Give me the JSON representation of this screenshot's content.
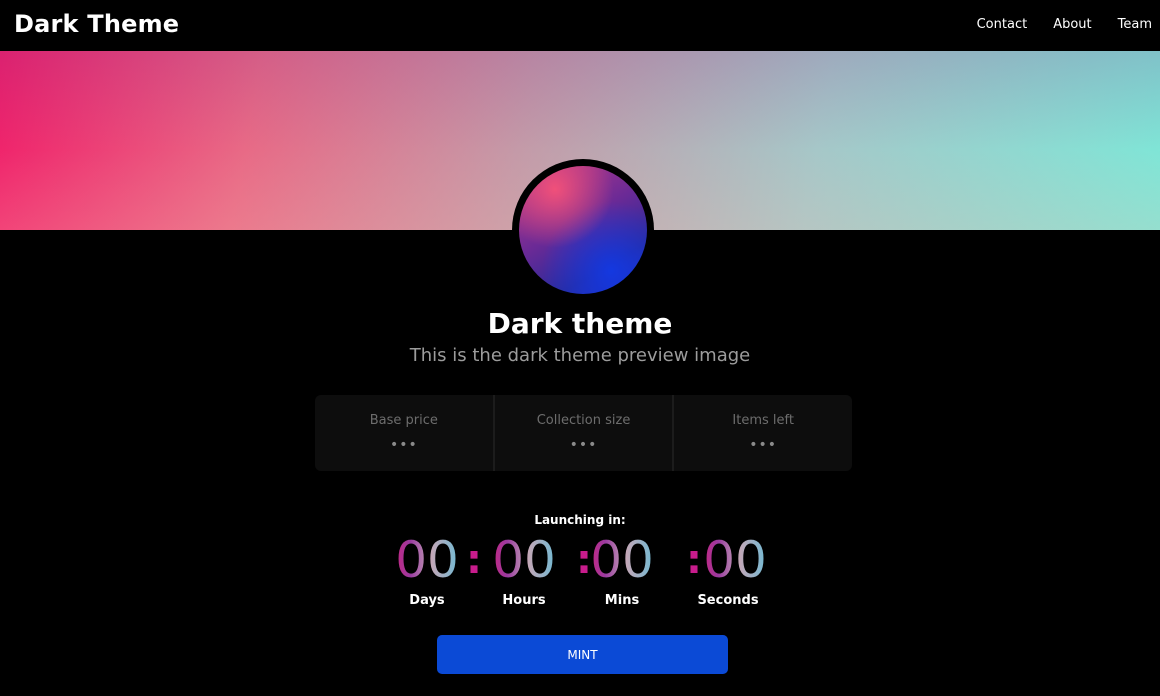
{
  "header": {
    "brand": "Dark Theme",
    "nav": [
      "Contact",
      "About",
      "Team"
    ]
  },
  "hero": {
    "title": "Dark theme",
    "subtitle": "This is the dark theme preview image"
  },
  "stats": [
    {
      "label": "Base price",
      "value": "•••"
    },
    {
      "label": "Collection size",
      "value": "•••"
    },
    {
      "label": "Items left",
      "value": "•••"
    }
  ],
  "countdown": {
    "label": "Launching in:",
    "separator": ":",
    "units": [
      {
        "value": "00",
        "label": "Days"
      },
      {
        "value": "00",
        "label": "Hours"
      },
      {
        "value": "00",
        "label": "Mins"
      },
      {
        "value": "00",
        "label": "Seconds"
      }
    ]
  },
  "mint_button": "MINT",
  "colors": {
    "background": "#000000",
    "button": "#0b4ad6",
    "accent_pink": "#e01a6f",
    "accent_cyan": "#53c2df"
  }
}
